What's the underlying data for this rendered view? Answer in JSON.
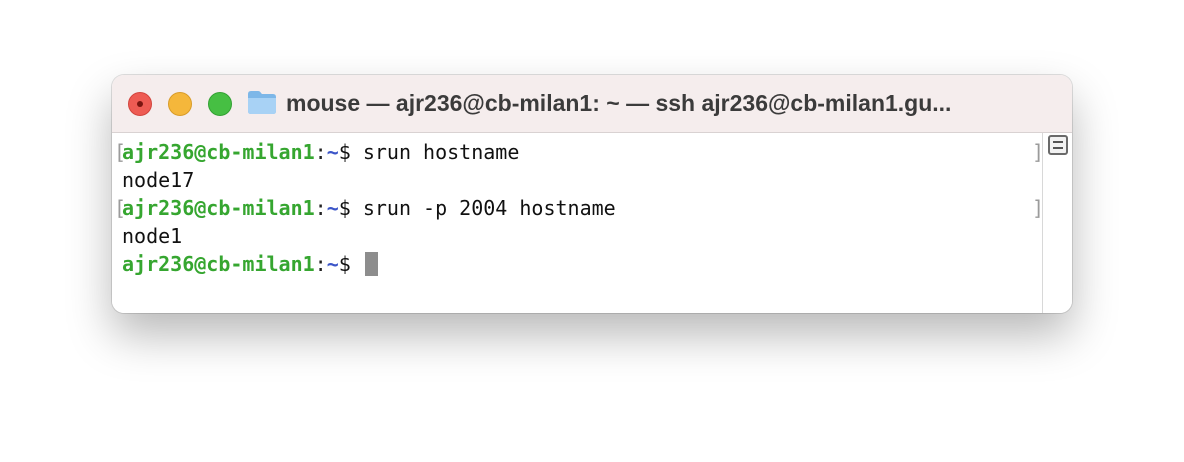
{
  "window": {
    "title": "mouse — ajr236@cb-milan1: ~ — ssh ajr236@cb-milan1.gu..."
  },
  "terminal": {
    "lines": [
      {
        "user": "ajr236@cb-milan1",
        "sep": ":",
        "path": "~",
        "symbol": "$ ",
        "command": "srun hostname"
      },
      {
        "output": "node17"
      },
      {
        "user": "ajr236@cb-milan1",
        "sep": ":",
        "path": "~",
        "symbol": "$ ",
        "command": "srun -p 2004 hostname"
      },
      {
        "output": "node1"
      },
      {
        "user": "ajr236@cb-milan1",
        "sep": ":",
        "path": "~",
        "symbol": "$ ",
        "command": ""
      }
    ],
    "bracket_open": "[",
    "bracket_close": "]"
  },
  "colors": {
    "prompt_user": "#36a630",
    "prompt_path": "#3b55c8",
    "titlebar": "#f5eded"
  },
  "icons": {
    "window_icon": "folder-icon",
    "split_button": "split-pane-icon"
  }
}
